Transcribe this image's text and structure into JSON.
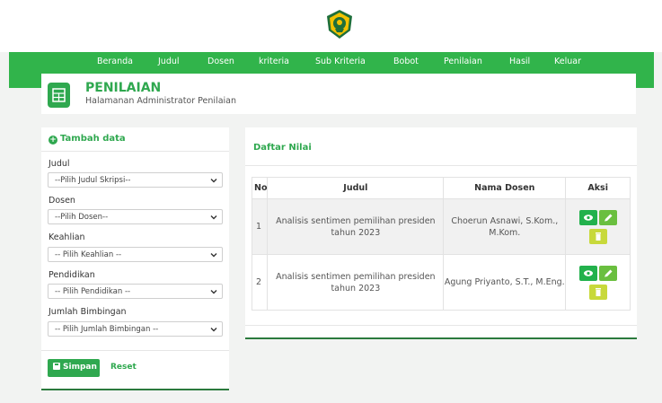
{
  "nav": {
    "items": [
      "Beranda",
      "Judul",
      "Dosen",
      "kriteria",
      "Sub Kriteria",
      "Bobot",
      "Penilaian",
      "Hasil",
      "Keluar"
    ]
  },
  "header": {
    "title": "PENILAIAN",
    "subtitle": "Halamanan Administrator Penilaian"
  },
  "form": {
    "heading": "Tambah data",
    "fields": [
      {
        "label": "Judul",
        "selected": "--Pilih Judul Skripsi--"
      },
      {
        "label": "Dosen",
        "selected": "--Pilih Dosen--"
      },
      {
        "label": "Keahlian",
        "selected": "-- Pilih Keahlian --"
      },
      {
        "label": "Pendidikan",
        "selected": "-- Pilih Pendidikan --"
      },
      {
        "label": "Jumlah Bimbingan",
        "selected": "-- Pilih Jumlah Bimbingan --"
      }
    ],
    "save_label": "Simpan",
    "reset_label": "Reset"
  },
  "table": {
    "heading": "Daftar Nilai",
    "columns": [
      "No",
      "Judul",
      "Nama Dosen",
      "Aksi"
    ],
    "rows": [
      {
        "no": "1",
        "judul": "Analisis sentimen pemilihan presiden tahun 2023",
        "dosen": "Choerun Asnawi, S.Kom., M.Kom."
      },
      {
        "no": "2",
        "judul": "Analisis sentimen pemilihan presiden tahun 2023",
        "dosen": "Agung Priyanto, S.T., M.Eng."
      }
    ]
  },
  "colors": {
    "accent": "#2fa84f",
    "navbar": "#31b44b",
    "view_button": "#22b14c",
    "edit_button": "#6abf3f",
    "delete_button": "#c8d93b"
  },
  "icons": {
    "logo": "university-crest-icon",
    "header": "spreadsheet-icon",
    "add": "plus-circle-icon",
    "save": "floppy-disk-icon",
    "view": "eye-icon",
    "edit": "pencil-icon",
    "delete": "trash-icon"
  }
}
